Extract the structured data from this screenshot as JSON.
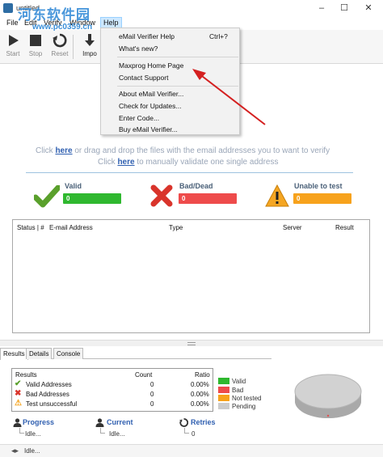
{
  "window": {
    "title": "untitled",
    "minimize_glyph": "–",
    "maximize_glyph": "☐",
    "close_glyph": "✕"
  },
  "watermark": {
    "text": "河东软件园",
    "url": "www.pc0359.cn"
  },
  "menu": {
    "file": "File",
    "edit": "Edit",
    "verify": "Verify",
    "window": "Window",
    "help": "Help"
  },
  "toolbar": {
    "start": "Start",
    "stop": "Stop",
    "reset": "Reset",
    "import": "Impo"
  },
  "help_menu": {
    "items": [
      {
        "label": "eMail Verifier Help",
        "shortcut": "Ctrl+?"
      },
      {
        "label": "What's new?"
      },
      {
        "label": "Maxprog Home Page"
      },
      {
        "label": "Contact Support"
      },
      {
        "label": "About eMail Verifier..."
      },
      {
        "label": "Check for Updates..."
      },
      {
        "label": "Enter Code..."
      },
      {
        "label": "Buy eMail Verifier..."
      }
    ]
  },
  "drop_zone": {
    "line1_prefix": "Click ",
    "line1_link": "here",
    "line1_suffix": " or drag and drop the files with the email addresses you to want to verify",
    "line2_prefix": "Click ",
    "line2_link": "here",
    "line2_suffix": " to manually validate one single address"
  },
  "stats": {
    "valid": {
      "label": "Valid",
      "value": "0",
      "color": "#2fb82f"
    },
    "bad": {
      "label": "Bad/Dead",
      "value": "0",
      "color": "#ee4b4b"
    },
    "unable": {
      "label": "Unable to test",
      "value": "0",
      "color": "#f7a21c"
    }
  },
  "table": {
    "columns": [
      "Status | #",
      "E-mail Address",
      "Type",
      "Server",
      "Result"
    ]
  },
  "bottom_tabs": [
    "Results",
    "Details",
    "Console"
  ],
  "results": {
    "header": {
      "label": "Results",
      "count": "Count",
      "ratio": "Ratio"
    },
    "rows": [
      {
        "label": "Valid Addresses",
        "count": "0",
        "ratio": "0.00%"
      },
      {
        "label": "Bad Addresses",
        "count": "0",
        "ratio": "0.00%"
      },
      {
        "label": "Test unsuccessful",
        "count": "0",
        "ratio": "0.00%"
      }
    ]
  },
  "legend": [
    {
      "label": "Valid",
      "color": "#2fb82f"
    },
    {
      "label": "Bad",
      "color": "#ee4b4b"
    },
    {
      "label": "Not tested",
      "color": "#f7a21c"
    },
    {
      "label": "Pending",
      "color": "#cccccc"
    }
  ],
  "progress": {
    "progress_label": "Progress",
    "progress_value": "Idle...",
    "current_label": "Current",
    "current_value": "Idle...",
    "retries_label": "Retries",
    "retries_value": "0"
  },
  "status": {
    "text": "Idle..."
  }
}
